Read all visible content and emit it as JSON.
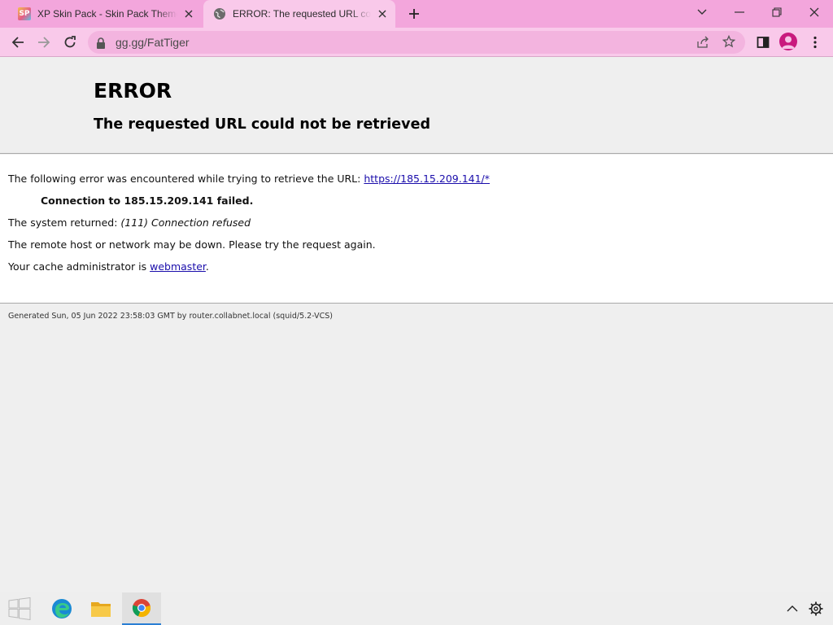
{
  "browser": {
    "tabs": [
      {
        "title": "XP Skin Pack - Skin Pack Theme for Windows",
        "favicon": "skin-pack-icon",
        "active": false
      },
      {
        "title": "ERROR: The requested URL could not be retrieved",
        "favicon": "globe-icon",
        "active": true
      }
    ],
    "address": "gg.gg/FatTiger"
  },
  "page": {
    "error_title": "ERROR",
    "error_subtitle": "The requested URL could not be retrieved",
    "intro_text": "The following error was encountered while trying to retrieve the URL: ",
    "url_link": "https://185.15.209.141/*",
    "connection_failed": "Connection to 185.15.209.141 failed.",
    "system_returned_label": "The system returned: ",
    "system_returned_value": "(111) Connection refused",
    "remote_host_text": "The remote host or network may be down. Please try the request again.",
    "cache_admin_text": "Your cache administrator is ",
    "cache_admin_link": "webmaster",
    "cache_admin_suffix": ".",
    "footer": "Generated Sun, 05 Jun 2022 23:58:03 GMT by router.collabnet.local (squid/5.2-VCS)"
  },
  "taskbar": {
    "items": [
      "start-icon",
      "edge-icon",
      "file-explorer-icon",
      "chrome-icon"
    ],
    "tray": [
      "chevron-up-icon",
      "gear-icon"
    ]
  },
  "colors": {
    "tabstrip": "#f3a6dc",
    "toolbar": "#f9c9ea",
    "omnibox": "#f3b4df",
    "link": "#1a0dab",
    "profile": "#c9197e"
  }
}
